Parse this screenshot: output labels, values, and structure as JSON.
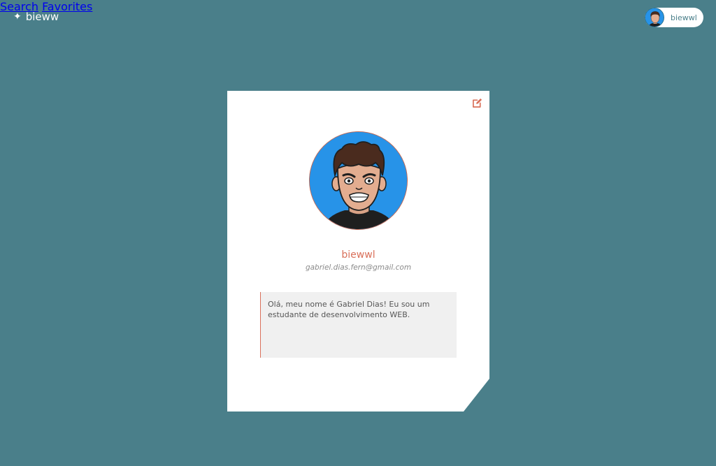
{
  "header": {
    "brand": "bieww",
    "brand_icon": "sparkle-icon",
    "nav": {
      "search_label": "Search",
      "favorites_label": "Favorites"
    },
    "user": {
      "name": "biewwl"
    }
  },
  "profile": {
    "name": "biewwl",
    "email": "gabriel.dias.fern@gmail.com",
    "bio": "Olá, meu nome é Gabriel Dias! Eu sou um estudante de desenvolvimento WEB.",
    "edit_icon": "edit-icon"
  },
  "colors": {
    "background": "#4a7f8a",
    "accent": "#d9705a",
    "avatar_bg": "#2793e8"
  }
}
